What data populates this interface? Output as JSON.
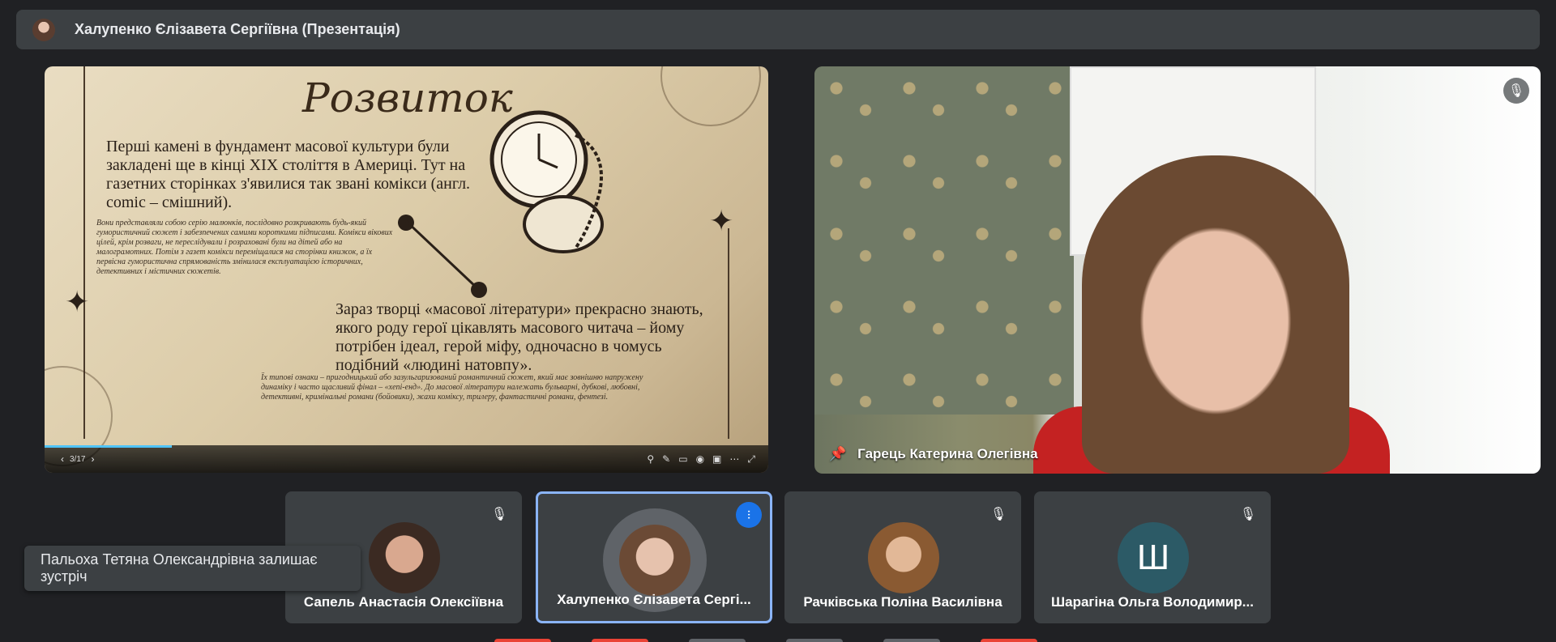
{
  "header": {
    "title": "Халупенко Єлізавета Сергіївна (Презентація)"
  },
  "slide": {
    "heading": "Розвиток",
    "paragraph1": "Перші камені в фундамент масової культури були закладені ще в кінці XIX століття в Америці. Тут на газетних сторінках з'явилися так звані комікси (англ. comic – смішний).",
    "small1": "Вони представляли собою серію малюнків, послідовно розкривають будь-який гумористичний сюжет і забезпечених самими короткими підписами. Комікси вікових цілей, крім розваги, не переслідували і розраховані були на дітей або на малограмотних. Потім з газет комікси переміщалися на сторінки книжок, а їх первісна гумористична спрямованість змінилася експлуатацією історичних, детективних і містичних сюжетів.",
    "paragraph2": "Зараз творці «масової літератури» прекрасно знають, якого роду герої цікавлять масового читача – йому потрібен ідеал, герой міфу, одночасно в чомусь подібний «людині натовпу».",
    "small2": "Їх типові ознаки – пригодницький або зазульгаризований романтичний сюжет, який має зовнішню напружену динаміку і часто щасливий фінал – «хепі-енд». До масової літератури належать бульварні, дубкові, любовні, детективні, кримінальні романи (бойовики), жахи коміксу, трилеру, фантастичні романи, фентезі.",
    "page_indicator": "3/17",
    "progress": 0.176
  },
  "camera": {
    "name": "Гарець Катерина Олегівна"
  },
  "participants": [
    {
      "name": "Сапель Анастасія Олексіївна",
      "initial": ""
    },
    {
      "name": "Халупенко Єлізавета Сергі...",
      "initial": ""
    },
    {
      "name": "Рачківська Поліна Василівна",
      "initial": ""
    },
    {
      "name": "Шарагіна Ольга Володимир...",
      "initial": "Ш"
    }
  ],
  "toast": {
    "text": "Пальоха Тетяна Олександрівна залишає зустріч"
  },
  "colors": {
    "background": "#202124",
    "tile": "#3c4043",
    "active_border": "#8ab4f8",
    "speaking": "#1a73e8"
  }
}
